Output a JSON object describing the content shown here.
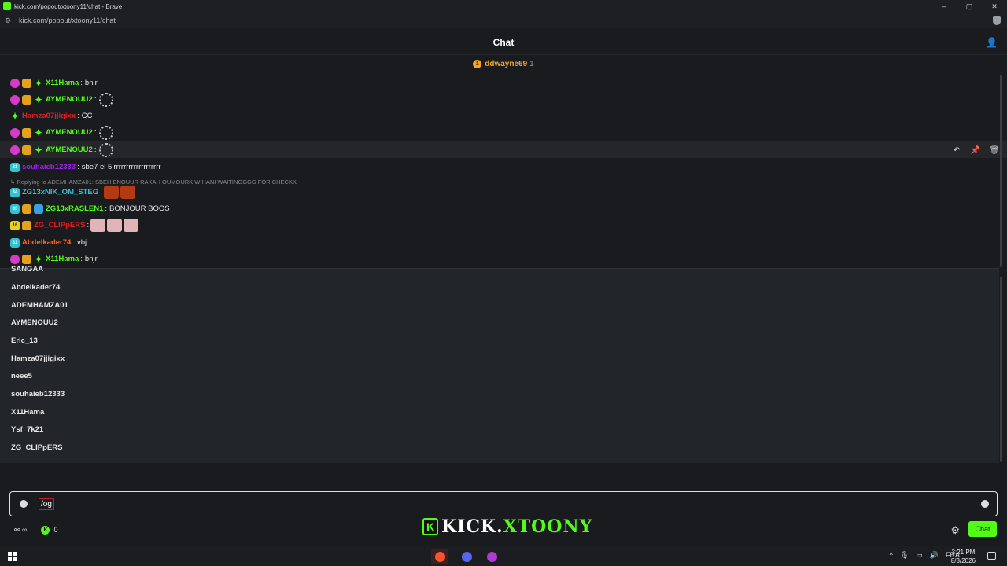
{
  "browser": {
    "window_title": "kick.com/popout/xtoony11/chat - Brave",
    "url": "kick.com/popout/xtoony11/chat",
    "controls": [
      "–",
      "▢",
      "✕"
    ]
  },
  "chat_header": {
    "title": "Chat"
  },
  "gifter": {
    "rank": "1",
    "name": "ddwayne69",
    "count": "1"
  },
  "messages": [
    {
      "user": "X11Hama",
      "color": "#53fc18",
      "text": "bnjr",
      "badges": [
        "sub",
        "crown",
        "og"
      ]
    },
    {
      "user": "AYMENOUU2",
      "color": "#53fc18",
      "text": "",
      "badges": [
        "sub",
        "crown",
        "og"
      ],
      "spinner": true
    },
    {
      "user": "Hamza07jjigixx",
      "color": "#e02020",
      "text": "CC",
      "badges": [
        "og"
      ]
    },
    {
      "user": "AYMENOUU2",
      "color": "#53fc18",
      "text": "",
      "badges": [
        "sub",
        "crown",
        "og"
      ],
      "spinner": true
    },
    {
      "user": "AYMENOUU2",
      "color": "#53fc18",
      "text": "",
      "badges": [
        "sub",
        "crown",
        "og"
      ],
      "spinner": true
    },
    {
      "user": "souhaieb12333",
      "color": "#a020f0",
      "text": "sbe7 el 5irrrrrrrrrrrrrrrrrrr",
      "badges": [
        "mo"
      ],
      "badge_label": "31"
    },
    {
      "user": "ZG13xNIK_OM_STEG",
      "color": "#2ec4d6",
      "text": "",
      "badges": [
        "mo"
      ],
      "badge_label": "34",
      "emotes": [
        "fire",
        "fire"
      ]
    },
    {
      "user": "ZG13xRASLEN1",
      "color": "#53fc18",
      "text": "BONJOUR BOOS",
      "badges": [
        "mo",
        "crown",
        "vip"
      ],
      "badge_label": "33"
    },
    {
      "user": "ZG_CLIPpERS",
      "color": "#e02020",
      "text": "",
      "badges": [
        "y",
        "crown"
      ],
      "badge_label": "16",
      "emotes": [
        "hand",
        "hand",
        "hand"
      ]
    },
    {
      "user": "Abdelkader74",
      "color": "#ff6a1a",
      "text": "vbj",
      "badges": [
        "mo"
      ],
      "badge_label": "31"
    },
    {
      "user": "X11Hama",
      "color": "#53fc18",
      "text": "bnjr",
      "badges": [
        "sub",
        "crown",
        "og"
      ]
    }
  ],
  "reply_line": "↳ Replying to ADEMHAMZA01: SBEH ENOUUR RAKAH OUMOURK W HANI WAITINGGGG FOR CHECKK",
  "userlist": {
    "cut_item": "SANGAA",
    "items": [
      "Abdelkader74",
      "ADEMHAMZA01",
      "AYMENOUU2",
      "Eric_13",
      "Hamza07jjigixx",
      "neee5",
      "souhaieb12333",
      "X11Hama",
      "Ysf_7k21",
      "ZG_CLIPpERS"
    ]
  },
  "input": {
    "value": "/og"
  },
  "bottom": {
    "points": "0",
    "chat_button": "Chat",
    "overlay_logo_k": "K",
    "overlay_logo_a": "KICK.",
    "overlay_logo_b": "XTOONY"
  },
  "taskbar": {
    "lang": "FRA",
    "time": "3:21 PM",
    "date": "8/3/2026"
  }
}
